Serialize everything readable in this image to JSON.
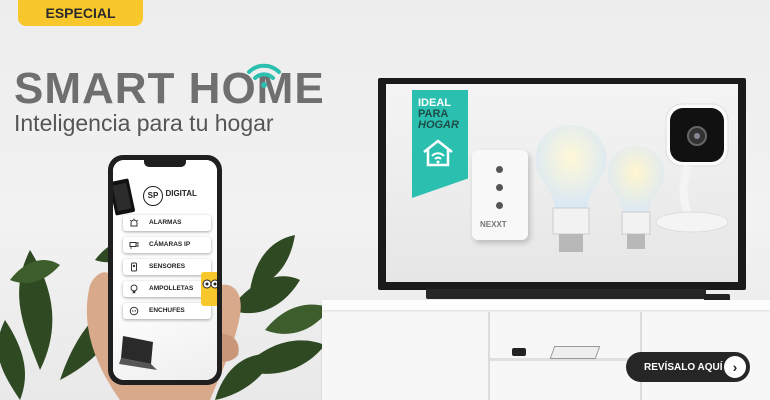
{
  "badge": "ESPECIAL",
  "hero": {
    "title_part1": "SMART H",
    "title_o": "O",
    "title_part2": "ME",
    "subtitle": "Inteligencia para tu hogar"
  },
  "tv_promo": {
    "line1": "IDEAL",
    "line2": "PARA",
    "line3": "HOGAR",
    "brand": "NEXXT"
  },
  "phone_app": {
    "logo_mark": "SP",
    "logo_text": "DIGITAL",
    "menu": [
      {
        "label": "ALARMAS",
        "icon": "siren-icon"
      },
      {
        "label": "CÁMARAS IP",
        "icon": "camera-icon"
      },
      {
        "label": "SENSORES",
        "icon": "sensor-icon"
      },
      {
        "label": "AMPOLLETAS",
        "icon": "bulb-icon"
      },
      {
        "label": "ENCHUFES",
        "icon": "plug-icon"
      }
    ]
  },
  "cta": {
    "label": "REVÍSALO AQUÍ",
    "icon": "chevron-right-icon"
  },
  "colors": {
    "badge": "#f7c72b",
    "accent_teal": "#2bbfb0",
    "title_gray": "#6f6f6f",
    "cta_bg": "#262626"
  }
}
